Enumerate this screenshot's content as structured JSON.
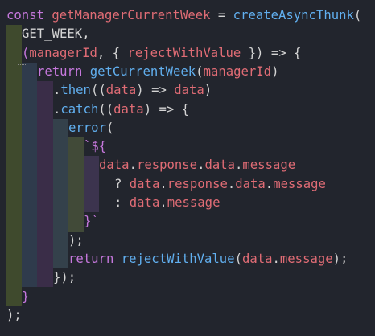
{
  "editor": {
    "colors": {
      "background": "#22252d",
      "keyword": "#c678dd",
      "function": "#61afef",
      "variable": "#e06c75",
      "plain": "#d4d4d4",
      "guide_1": "#3f4a2d",
      "guide_2": "#2f3b4c",
      "guide_3": "#3a2d48",
      "guide_4": "#34414b",
      "guide_5": "#414a38",
      "guide_6": "#3c344e"
    },
    "lines": [
      [
        [
          "const",
          "kw"
        ],
        [
          " ",
          "pl"
        ],
        [
          "getManagerCurrentWeek",
          "var"
        ],
        [
          " = ",
          "pl"
        ],
        [
          "createAsyncThunk",
          "fn"
        ],
        [
          "(",
          "pl"
        ]
      ],
      [
        [
          "GET_WEEK,",
          "pl"
        ]
      ],
      [
        [
          "(",
          "kw"
        ],
        [
          "managerId",
          "var"
        ],
        [
          ", { ",
          "pl"
        ],
        [
          "rejectWithValue",
          "var"
        ],
        [
          " }) => {",
          "pl"
        ]
      ],
      [
        [
          "return",
          "kw"
        ],
        [
          " ",
          "pl"
        ],
        [
          "getCurrentWeek",
          "fn"
        ],
        [
          "(",
          "pl"
        ],
        [
          "managerId",
          "var"
        ],
        [
          ")",
          "pl"
        ]
      ],
      [
        [
          ".",
          "pl"
        ],
        [
          "then",
          "fn"
        ],
        [
          "((",
          "pl"
        ],
        [
          "data",
          "var"
        ],
        [
          ") => ",
          "pl"
        ],
        [
          "data",
          "var"
        ],
        [
          ")",
          "pl"
        ]
      ],
      [
        [
          ".",
          "pl"
        ],
        [
          "catch",
          "fn"
        ],
        [
          "((",
          "pl"
        ],
        [
          "data",
          "var"
        ],
        [
          ") => {",
          "pl"
        ]
      ],
      [
        [
          "error",
          "fn"
        ],
        [
          "(",
          "pl"
        ]
      ],
      [
        [
          "`${",
          "kw"
        ]
      ],
      [
        [
          "data",
          "var"
        ],
        [
          ".",
          "pl"
        ],
        [
          "response",
          "var"
        ],
        [
          ".",
          "pl"
        ],
        [
          "data",
          "var"
        ],
        [
          ".",
          "pl"
        ],
        [
          "message",
          "var"
        ]
      ],
      [
        [
          "? ",
          "pl"
        ],
        [
          "data",
          "var"
        ],
        [
          ".",
          "pl"
        ],
        [
          "response",
          "var"
        ],
        [
          ".",
          "pl"
        ],
        [
          "data",
          "var"
        ],
        [
          ".",
          "pl"
        ],
        [
          "message",
          "var"
        ]
      ],
      [
        [
          ": ",
          "pl"
        ],
        [
          "data",
          "var"
        ],
        [
          ".",
          "pl"
        ],
        [
          "message",
          "var"
        ]
      ],
      [
        [
          "}`",
          "kw"
        ]
      ],
      [
        [
          ");",
          "pl"
        ]
      ],
      [
        [
          "return",
          "kw"
        ],
        [
          " ",
          "pl"
        ],
        [
          "rejectWithValue",
          "fn"
        ],
        [
          "(",
          "pl"
        ],
        [
          "data",
          "var"
        ],
        [
          ".",
          "pl"
        ],
        [
          "message",
          "var"
        ],
        [
          ");",
          "pl"
        ]
      ],
      [
        [
          "});",
          "pl"
        ]
      ],
      [
        [
          "}",
          "kw"
        ]
      ],
      [
        [
          ");",
          "pl"
        ]
      ]
    ]
  }
}
